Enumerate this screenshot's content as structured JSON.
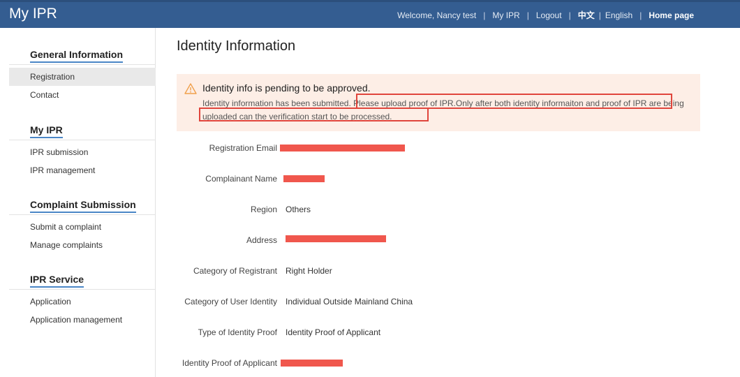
{
  "header": {
    "logo": "My IPR",
    "welcome": "Welcome, Nancy test",
    "my_ipr": "My IPR",
    "logout": "Logout",
    "lang_cn": "中文",
    "lang_en": "English",
    "home": "Home page"
  },
  "sidebar": {
    "sections": [
      {
        "title": "General Information",
        "items": [
          "Registration",
          "Contact"
        ]
      },
      {
        "title": "My IPR",
        "items": [
          "IPR submission",
          "IPR management"
        ]
      },
      {
        "title": "Complaint Submission",
        "items": [
          "Submit a complaint",
          "Manage complaints"
        ]
      },
      {
        "title": "IPR Service",
        "items": [
          "Application",
          "Application management"
        ]
      }
    ],
    "active_item": "Registration"
  },
  "main": {
    "title": "Identity Information",
    "notice": {
      "title": "Identity info is pending to be approved.",
      "text": "Identity information has been submitted. Please upload proof of IPR.Only after both identity informaiton and proof of IPR are being uploaded can the verification start to be processed."
    },
    "fields": [
      {
        "label": "Registration Email",
        "value": ""
      },
      {
        "label": "Complainant Name",
        "value": ""
      },
      {
        "label": "Region",
        "value": "Others"
      },
      {
        "label": "Address",
        "value": ""
      },
      {
        "label": "Category of Registrant",
        "value": "Right Holder"
      },
      {
        "label": "Category of User Identity",
        "value": "Individual Outside Mainland China"
      },
      {
        "label": "Type of Identity Proof",
        "value": "Identity Proof of Applicant"
      },
      {
        "label": "Identity Proof of Applicant",
        "value": ""
      }
    ]
  },
  "colors": {
    "header_bg": "#345d91",
    "notice_bg": "#fdeee6",
    "highlight_border": "#e0453c",
    "redaction": "#f0574d"
  }
}
